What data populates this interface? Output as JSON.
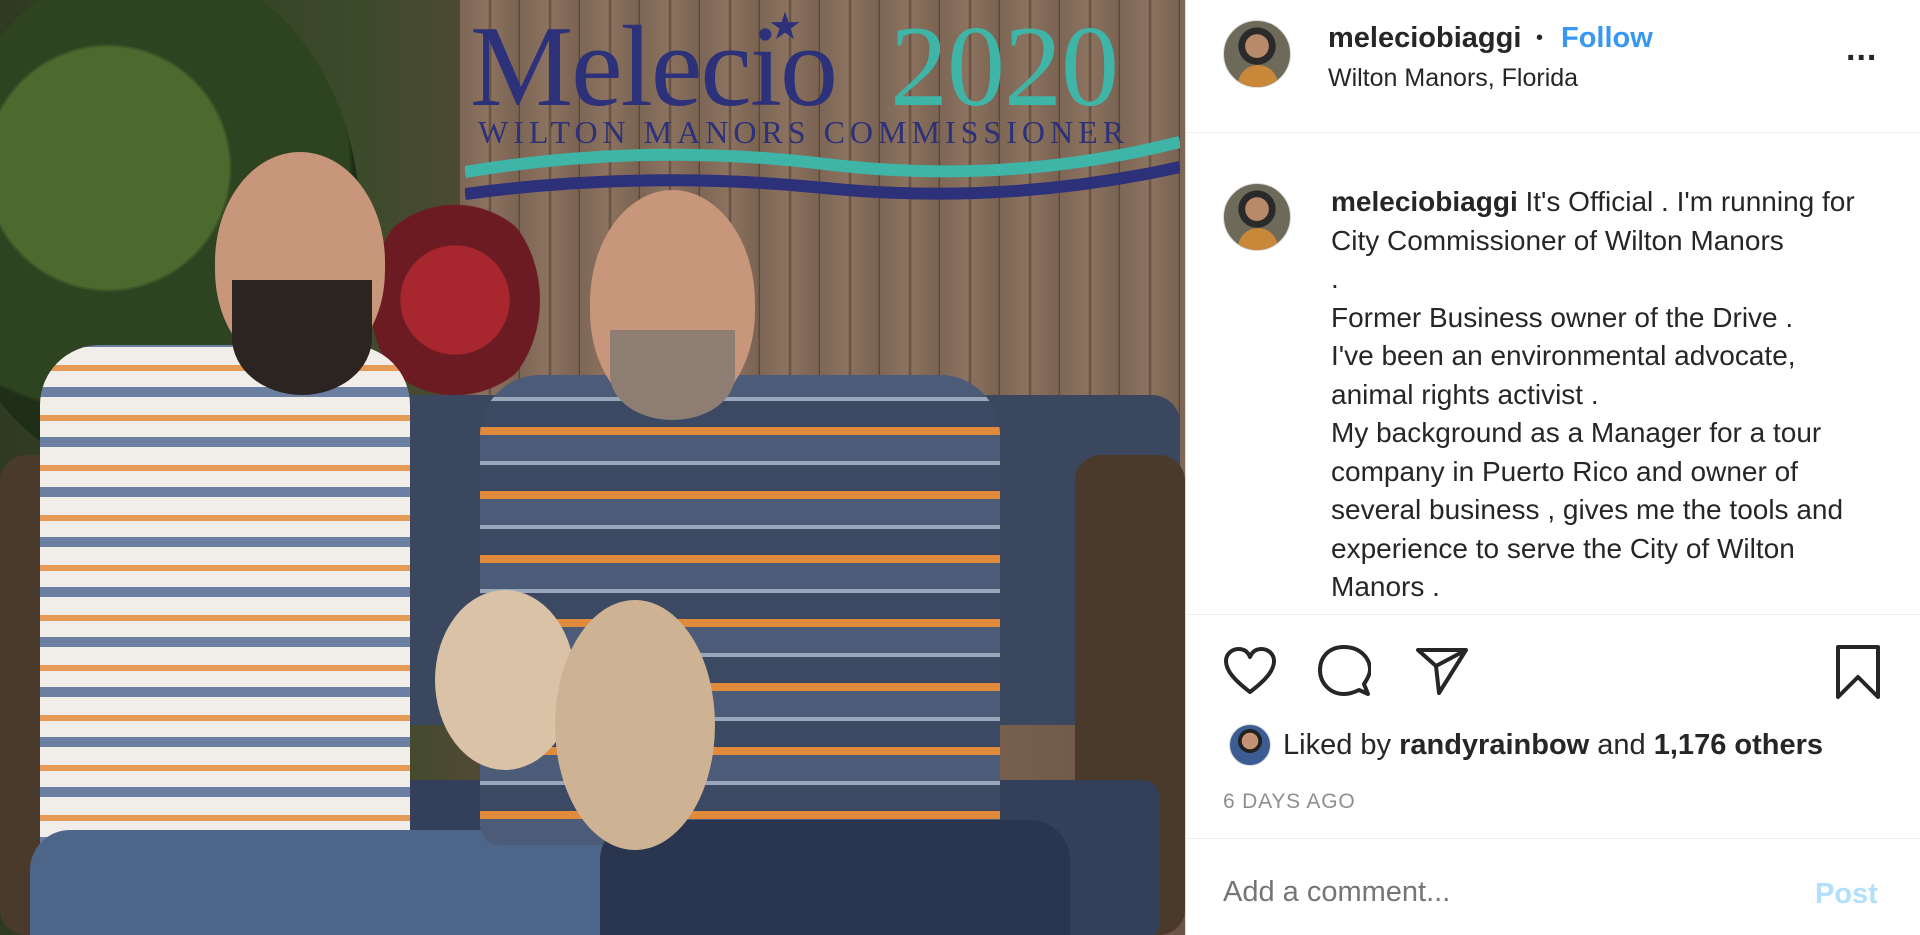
{
  "header": {
    "username": "meleciobiaggi",
    "separator": "•",
    "follow_label": "Follow",
    "location": "Wilton Manors, Florida",
    "more_label": "..."
  },
  "photo": {
    "logo_name": "Melecio",
    "logo_year": "2020",
    "logo_subtitle": "WILTON MANORS COMMISSIONER",
    "logo_star": "★"
  },
  "caption": {
    "username": "meleciobiaggi",
    "lines": [
      "It's Official . I'm running for City Commissioner of Wilton Manors",
      ".",
      "Former Business owner of the Drive .",
      "I've been an environmental advocate,",
      "animal rights activist .",
      "My background as a Manager for a tour company in Puerto Rico and owner of several business , gives me the tools and experience to serve the City of Wilton Manors ."
    ]
  },
  "actions": {
    "like_icon": "heart-icon",
    "comment_icon": "comment-icon",
    "share_icon": "share-icon",
    "save_icon": "bookmark-icon"
  },
  "likes": {
    "prefix": "Liked by",
    "user": "randyrainbow",
    "conjunction": "and",
    "others": "1,176 others"
  },
  "timestamp": "6 DAYS AGO",
  "comment": {
    "placeholder": "Add a comment...",
    "post_label": "Post"
  },
  "colors": {
    "link_blue": "#3897f0",
    "post_disabled": "#b2dffc",
    "text": "#262626",
    "muted": "#8e8e8e"
  }
}
